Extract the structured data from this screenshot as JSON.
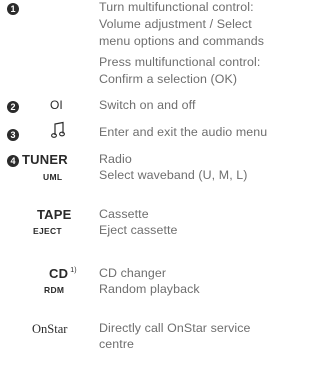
{
  "items": [
    {
      "number": "1",
      "lines": [
        "Turn multifunctional control:",
        "Volume adjustment / Select",
        "menu options and commands",
        "Press multifunctional control:",
        "Confirm a selection (OK)"
      ]
    },
    {
      "number": "2",
      "symbol": "OI",
      "text": "Switch on and off"
    },
    {
      "number": "3",
      "symbol_icon": "music-note-icon",
      "text": "Enter and exit the audio menu"
    },
    {
      "number": "4",
      "label": "TUNER",
      "text": "Radio",
      "sub_label": "UML",
      "sub_text": "Select waveband (U, M, L)"
    }
  ],
  "tape": {
    "label": "TAPE",
    "text": "Cassette",
    "sub_label": "EJECT",
    "sub_text": "Eject cassette"
  },
  "cd": {
    "label": "CD",
    "footnote": "1)",
    "text": "CD changer",
    "sub_label": "RDM",
    "sub_text": "Random playback"
  },
  "onstar": {
    "logo_text": "OnStar",
    "lines": [
      "Directly call OnStar service",
      "centre"
    ]
  }
}
